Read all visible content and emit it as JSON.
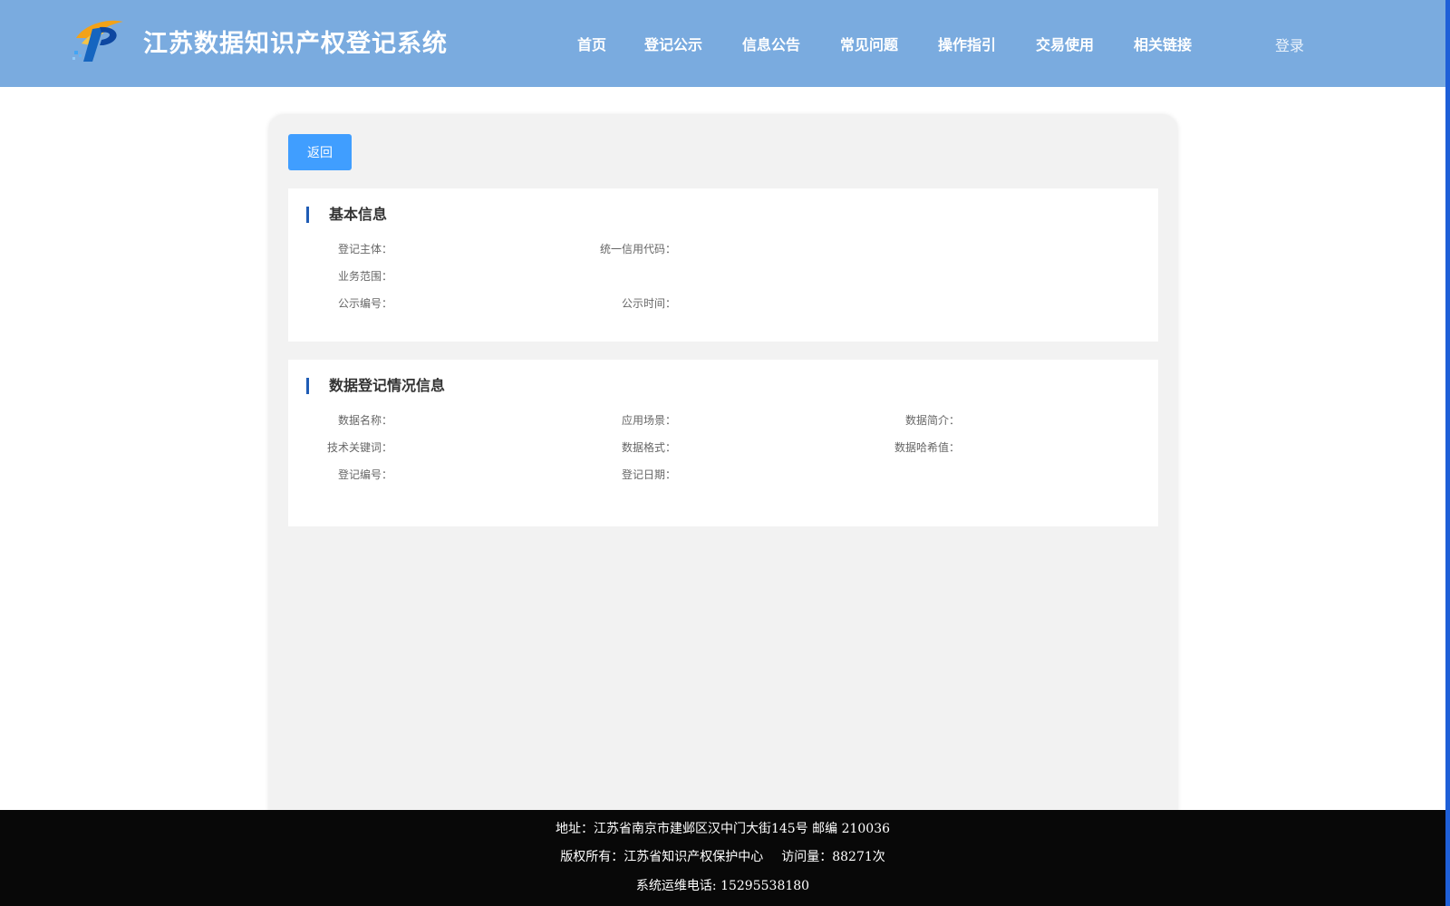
{
  "header": {
    "title": "江苏数据知识产权登记系统",
    "logo_icon": "ip-logo-icon",
    "login_label": "登录",
    "nav": [
      {
        "label": "首页"
      },
      {
        "label": "登记公示"
      },
      {
        "label": "信息公告"
      },
      {
        "label": "常见问题"
      },
      {
        "label": "操作指引"
      },
      {
        "label": "交易使用"
      },
      {
        "label": "相关链接"
      }
    ]
  },
  "back_label": "返回",
  "basic": {
    "title": "基本信息",
    "subject_label": "登记主体：",
    "credit_code_label": "统一信用代码：",
    "scope_label": "业务范围：",
    "pub_no_label": "公示编号：",
    "pub_time_label": "公示时间："
  },
  "data_info": {
    "title": "数据登记情况信息",
    "name_label": "数据名称：",
    "scenario_label": "应用场景：",
    "intro_label": "数据简介：",
    "keywords_label": "技术关键词：",
    "format_label": "数据格式：",
    "hash_label": "数据哈希值：",
    "reg_no_label": "登记编号：",
    "reg_date_label": "登记日期："
  },
  "footer": {
    "address": "地址：江苏省南京市建邺区汉中门大街145号 邮编 210036",
    "copyright": "版权所有：江苏省知识产权保护中心",
    "visits": "访问量：88271次",
    "phone": "系统运维电话: 15295538180"
  },
  "colors": {
    "header_bg": "#7aabdf",
    "primary_button": "#409eff",
    "title_bar": "#1f5cb5",
    "footer_bg": "#080808",
    "edge_accent": "#1e5fd8"
  }
}
